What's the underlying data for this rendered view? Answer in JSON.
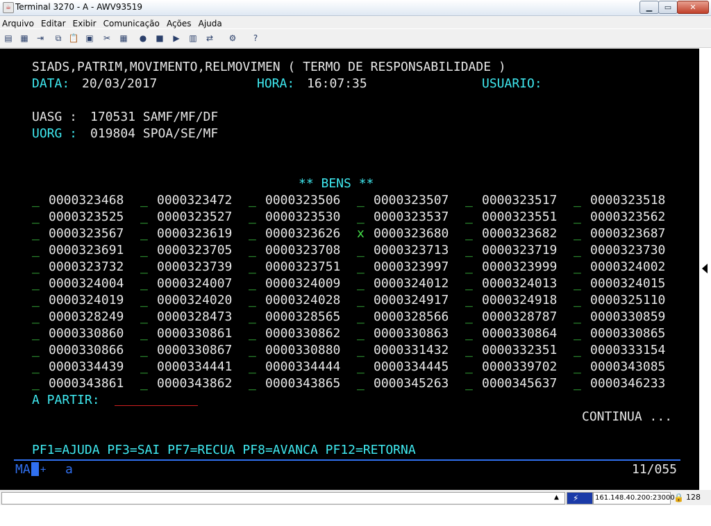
{
  "window": {
    "title": "Terminal 3270 - A - AWV93519"
  },
  "menu": [
    "Arquivo",
    "Editar",
    "Exibir",
    "Comunicação",
    "Ações",
    "Ajuda"
  ],
  "toolbar_icons": [
    "print-icon",
    "print-setup-icon",
    "send-icon",
    "copy-icon",
    "paste-icon",
    "paste-next-icon",
    "cut-icon",
    "select-all-icon",
    "macro-record-icon",
    "macro-stop-icon",
    "macro-play-icon",
    "keypad-icon",
    "file-transfer-icon",
    "settings-icon",
    "help-icon"
  ],
  "terminal": {
    "header": "SIADS,PATRIM,MOVIMENTO,RELMOVIMEN ( TERMO DE RESPONSABILIDADE )",
    "data_label": "DATA:",
    "data_value": "20/03/2017",
    "hora_label": "HORA:",
    "hora_value": "16:07:35",
    "usuario_label": "USUARIO:",
    "uasg_label": "UASG :",
    "uasg_value": "170531 SAMF/MF/DF",
    "uorg_label": "UORG :",
    "uorg_value": "019804 SPOA/SE/MF",
    "bens_title": "** BENS **",
    "bens_rows": [
      [
        "0000323468",
        "0000323472",
        "0000323506",
        "0000323507",
        "0000323517",
        "0000323518"
      ],
      [
        "0000323525",
        "0000323527",
        "0000323530",
        "0000323537",
        "0000323551",
        "0000323562"
      ],
      [
        "0000323567",
        "0000323619",
        "0000323626",
        "0000323680",
        "0000323682",
        "0000323687"
      ],
      [
        "0000323691",
        "0000323705",
        "0000323708",
        "0000323713",
        "0000323719",
        "0000323730"
      ],
      [
        "0000323732",
        "0000323739",
        "0000323751",
        "0000323997",
        "0000323999",
        "0000324002"
      ],
      [
        "0000324004",
        "0000324007",
        "0000324009",
        "0000324012",
        "0000324013",
        "0000324015"
      ],
      [
        "0000324019",
        "0000324020",
        "0000324028",
        "0000324917",
        "0000324918",
        "0000325110"
      ],
      [
        "0000328249",
        "0000328473",
        "0000328565",
        "0000328566",
        "0000328787",
        "0000330859"
      ],
      [
        "0000330860",
        "0000330861",
        "0000330862",
        "0000330863",
        "0000330864",
        "0000330865"
      ],
      [
        "0000330866",
        "0000330867",
        "0000330880",
        "0000331432",
        "0000332351",
        "0000333154"
      ],
      [
        "0000334439",
        "0000334441",
        "0000334444",
        "0000334445",
        "0000339702",
        "0000343085"
      ],
      [
        "0000343861",
        "0000343862",
        "0000343865",
        "0000345263",
        "0000345637",
        "0000346233"
      ]
    ],
    "selection_mark": "x",
    "selected_cell": [
      2,
      3
    ],
    "empty_mark": "_",
    "a_partir_label": "A PARTIR:",
    "continua": "CONTINUA ...",
    "pf_keys": "PF1=AJUDA PF3=SAI PF7=RECUA PF8=AVANCA PF12=RETORNA"
  },
  "oia": {
    "left": "MA",
    "plus": "+",
    "mode": "a",
    "cursor_pos": "11/055"
  },
  "status": {
    "host": "161.148.40.200:23000",
    "key_length": "128"
  },
  "colors": {
    "terminal_bg": "#000000",
    "text_white": "#e8e8e8",
    "text_cyan": "#3fe9f0",
    "text_green": "#45e04a",
    "oia_blue": "#3070f0"
  }
}
